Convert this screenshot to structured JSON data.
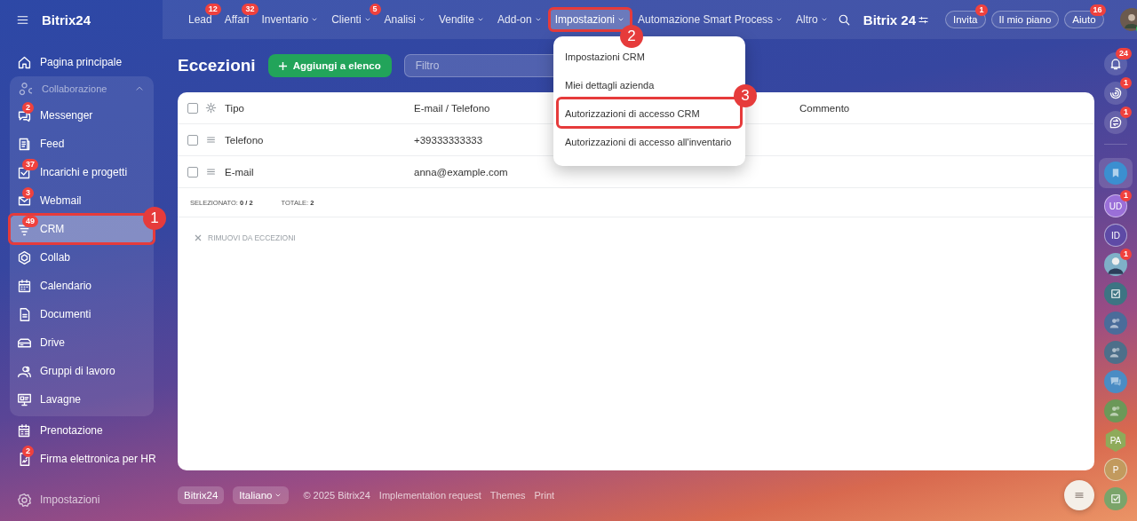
{
  "header": {
    "logo": "Bitrix24",
    "nav": [
      {
        "label": "Lead",
        "badge": "12",
        "caret": false,
        "selected": false
      },
      {
        "label": "Affari",
        "badge": "32",
        "caret": false,
        "selected": false
      },
      {
        "label": "Inventario",
        "caret": true,
        "selected": false
      },
      {
        "label": "Clienti",
        "badge": "5",
        "caret": true,
        "selected": false
      },
      {
        "label": "Analisi",
        "caret": true,
        "selected": false
      },
      {
        "label": "Vendite",
        "caret": true,
        "selected": false
      },
      {
        "label": "Add-on",
        "caret": true,
        "selected": false
      },
      {
        "label": "Impostazioni",
        "caret": true,
        "selected": true,
        "callout": "2"
      },
      {
        "label": "Automazione Smart Process",
        "caret": true,
        "selected": false
      },
      {
        "label": "Altro",
        "caret": true,
        "selected": false
      }
    ],
    "brand": "Bitrix 24",
    "buttons": [
      {
        "label": "Invita",
        "badge": "1"
      },
      {
        "label": "Il mio piano"
      },
      {
        "label": "Aiuto",
        "badge": "16"
      }
    ]
  },
  "sidebar": {
    "items": [
      {
        "label": "Pagina principale",
        "selected": false
      },
      {
        "label": "Collaborazione",
        "expanded": true,
        "children": [
          {
            "label": "Messenger",
            "badge": "2",
            "selected": false
          },
          {
            "label": "Feed",
            "selected": false
          },
          {
            "label": "Incarichi e progetti",
            "badge": "37",
            "selected": false
          },
          {
            "label": "Webmail",
            "badge": "3",
            "selected": false
          },
          {
            "label": "CRM",
            "badge": "49",
            "selected": true,
            "callout": "1"
          },
          {
            "label": "Collab",
            "selected": false
          },
          {
            "label": "Calendario",
            "selected": false
          },
          {
            "label": "Documenti",
            "selected": false
          },
          {
            "label": "Drive",
            "selected": false
          },
          {
            "label": "Gruppi di lavoro",
            "selected": false
          },
          {
            "label": "Lavagne",
            "selected": false
          }
        ]
      },
      {
        "label": "Prenotazione",
        "selected": false
      },
      {
        "label": "Firma elettronica per HR",
        "badge": "2",
        "selected": false
      }
    ],
    "settings": "Impostazioni"
  },
  "page": {
    "title": "Eccezioni",
    "add_button": "Aggiungi a elenco",
    "filter": {
      "placeholder": "Filtro"
    }
  },
  "menu": {
    "items": [
      {
        "label": "Impostazioni CRM"
      },
      {
        "label": "Miei dettagli azienda"
      },
      {
        "label": "Autorizzazioni di accesso CRM",
        "callout": "3"
      },
      {
        "label": "Autorizzazioni di accesso all'inventario"
      }
    ]
  },
  "table": {
    "header_checked": false,
    "columns": [
      "Tipo",
      "E-mail / Telefono",
      "Commento"
    ],
    "rows": [
      {
        "type": "Telefono",
        "contact": "+39333333333",
        "checked": false
      },
      {
        "type": "E-mail",
        "contact": "anna@example.com",
        "checked": false
      }
    ],
    "selected_label": "SELEZIONATO:",
    "selected_value": "0 / 2",
    "total_label": "TOTALE:",
    "total_value": "2",
    "action": {
      "label": "RIMUOVI DA ECCEZIONI",
      "disabled": true
    }
  },
  "footer": {
    "logo": "Bitrix24",
    "language": "Italiano",
    "copyright": "© 2025 Bitrix24",
    "links": [
      "Implementation request",
      "Themes",
      "Print"
    ]
  },
  "rail": [
    {
      "kind": "bell",
      "badge": "24"
    },
    {
      "kind": "sync",
      "badge": "1"
    },
    {
      "kind": "exchange",
      "badge": "1"
    },
    {
      "kind": "bookmark"
    },
    {
      "kind": "initials",
      "text": "UD",
      "color": "#9a6fd8",
      "badge": "1"
    },
    {
      "kind": "initials",
      "text": "ID",
      "color": "#5e4aa6"
    },
    {
      "kind": "photo",
      "badge": "1"
    },
    {
      "kind": "task",
      "color": "#3d7483"
    },
    {
      "kind": "group",
      "color": "#4a6c9a"
    },
    {
      "kind": "group",
      "color": "#4d6f8a"
    },
    {
      "kind": "chat",
      "color": "#4a8cc4"
    },
    {
      "kind": "group",
      "color": "#6b9858"
    },
    {
      "kind": "hexagon",
      "text": "PA",
      "color": "#8eab5a"
    },
    {
      "kind": "initials",
      "text": "P",
      "color": "#c29a5e"
    },
    {
      "kind": "task",
      "color": "#7aa46a"
    }
  ]
}
